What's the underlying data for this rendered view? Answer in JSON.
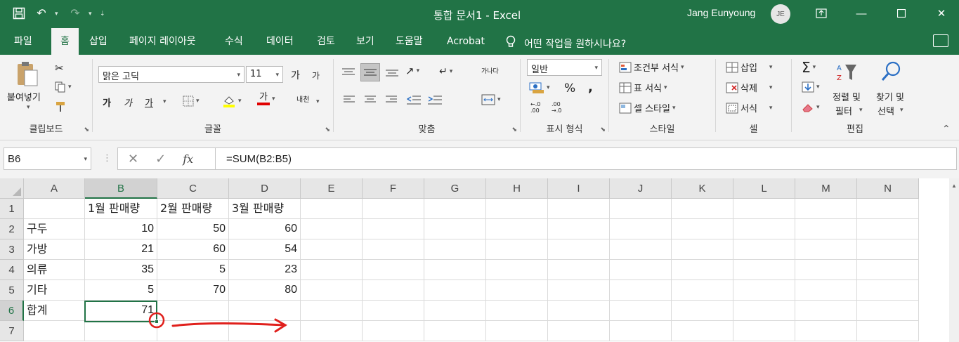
{
  "window": {
    "title": "통합 문서1  -  Excel",
    "user_name": "Jang Eunyoung",
    "user_initials": "JE"
  },
  "tabs": [
    "파일",
    "홈",
    "삽입",
    "페이지 레이아웃",
    "수식",
    "데이터",
    "검토",
    "보기",
    "도움말",
    "Acrobat"
  ],
  "active_tab": "홈",
  "tell_me": "어떤 작업을 원하시나요?",
  "ribbon": {
    "clipboard": {
      "paste_label": "붙여넣기",
      "group_label": "클립보드"
    },
    "font": {
      "font_name": "맑은 고딕",
      "font_size": "11",
      "grow": "가",
      "shrink": "가",
      "bold": "가",
      "italic": "가",
      "underline": "가",
      "font_color_glyph": "가",
      "phonetic": "내천",
      "group_label": "글꼴"
    },
    "alignment": {
      "wrap": "가나다",
      "group_label": "맞춤"
    },
    "number": {
      "format": "일반",
      "percent": "%",
      "comma": ",",
      "inc_decimal": "←.0 .00",
      "dec_decimal": ".00 →.0",
      "group_label": "표시 형식"
    },
    "styles": {
      "conditional": "조건부 서식",
      "table": "표 서식",
      "cell": "셀 스타일",
      "group_label": "스타일"
    },
    "cells": {
      "insert": "삽입",
      "delete": "삭제",
      "format": "서식",
      "group_label": "셀"
    },
    "editing": {
      "sort_line1": "정렬 및",
      "sort_line2": "필터",
      "find_line1": "찾기 및",
      "find_line2": "선택",
      "group_label": "편집"
    }
  },
  "formula_bar": {
    "name_box": "B6",
    "formula": "=SUM(B2:B5)",
    "cancel": "✕",
    "enter": "✓",
    "fx": "fx"
  },
  "sheet": {
    "columns": [
      "A",
      "B",
      "C",
      "D",
      "E",
      "F",
      "G",
      "H",
      "I",
      "J",
      "K",
      "L",
      "M",
      "N"
    ],
    "rows": [
      "1",
      "2",
      "3",
      "4",
      "5",
      "6",
      "7"
    ],
    "active_cell": "B6",
    "cells": [
      [
        "",
        "1월 판매량",
        "2월 판매량",
        "3월 판매량"
      ],
      [
        "구두",
        "10",
        "50",
        "60"
      ],
      [
        "가방",
        "21",
        "60",
        "54"
      ],
      [
        "의류",
        "35",
        "5",
        "23"
      ],
      [
        "기타",
        "5",
        "70",
        "80"
      ],
      [
        "합계",
        "71",
        "",
        ""
      ],
      [
        "",
        "",
        "",
        ""
      ]
    ]
  },
  "annotation": {
    "color": "#e0201c"
  },
  "colors": {
    "excel_green": "#217346",
    "ribbon_bg": "#f3f3f3"
  }
}
